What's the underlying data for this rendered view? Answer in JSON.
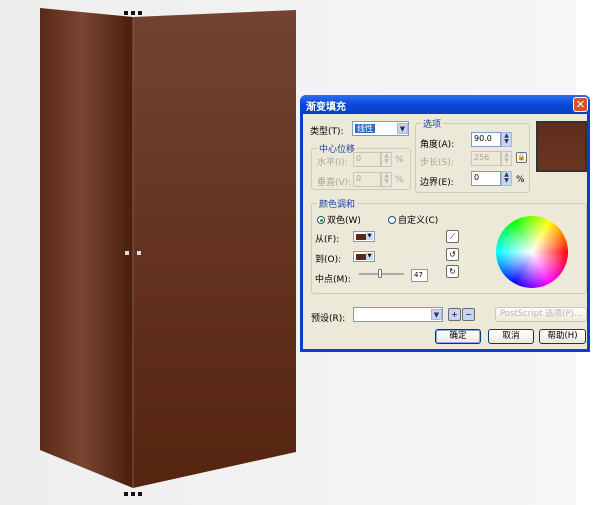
{
  "canvas": {
    "panel_colors": {
      "dark": "#4f2210",
      "light": "#7a4634"
    }
  },
  "dialog": {
    "title": "渐变填充",
    "type_label": "类型(T):",
    "type_value": "线性",
    "center_offset": {
      "title": "中心位移",
      "horizontal_label": "水平(I):",
      "horizontal_value": "0",
      "vertical_label": "垂直(V):",
      "vertical_value": "0",
      "unit": "%"
    },
    "options": {
      "title": "选项",
      "angle_label": "角度(A):",
      "angle_value": "90.0",
      "steps_label": "步长(S):",
      "steps_value": "256",
      "edge_label": "边界(E):",
      "edge_value": "0",
      "unit": "%"
    },
    "blend": {
      "title": "颜色调和",
      "two_color_label": "双色(W)",
      "custom_label": "自定义(C)",
      "selected": "two_color",
      "from_label": "从(F):",
      "to_label": "到(O):",
      "from_color": "#5a2a18",
      "to_color": "#5a2a18",
      "midpoint_label": "中点(M):",
      "midpoint_value": "47"
    },
    "preset_label": "预设(R):",
    "preset_value": "",
    "postscript_label": "PostScript 选项(P)...",
    "ok_label": "确定",
    "cancel_label": "取消",
    "help_label": "帮助(H)",
    "preview_color": "#5e2d1b"
  }
}
